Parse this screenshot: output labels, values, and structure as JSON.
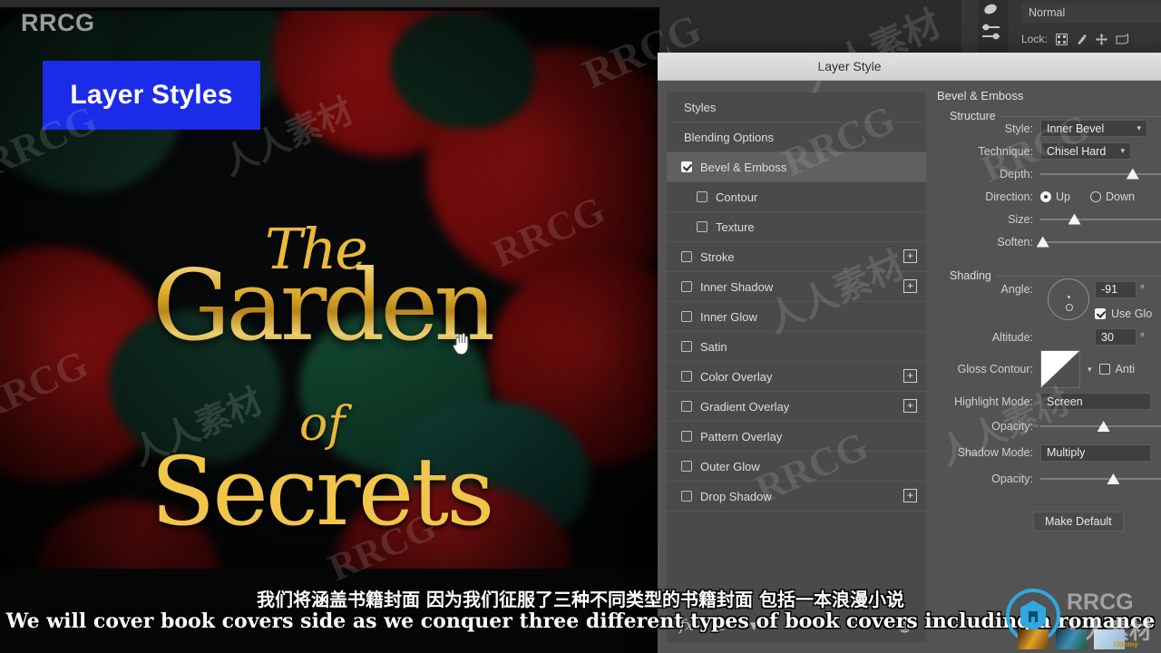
{
  "watermark": {
    "brand": "RRCG",
    "brand_cjk": "人人素材",
    "corner_label": "RRCG",
    "udemy": "Udemy",
    "tiles": [
      "RRCG",
      "人人素材",
      "RRCG",
      "RRCG",
      "人人素材",
      "RRCG",
      "人人素材",
      "RRCG"
    ]
  },
  "canvas": {
    "chip_label": "Layer Styles",
    "chip_color": "#1b2ce8",
    "cover_title_line1": "The",
    "cover_title_line2": "Garden",
    "cover_title_line3": "of",
    "cover_title_line4": "Secrets",
    "cursor": "hand-cursor"
  },
  "photoshop": {
    "blend_mode": "Normal",
    "lock_label": "Lock:",
    "lock_icons": [
      "lock-transparent-pixels-icon",
      "lock-image-pixels-icon",
      "lock-position-icon",
      "lock-artboard-icon"
    ]
  },
  "dialog": {
    "title": "Layer Style",
    "styles_list": [
      {
        "label": "Styles",
        "type": "plain",
        "checkbox": null,
        "plus": false,
        "selected": false,
        "indent": 0
      },
      {
        "label": "Blending Options",
        "type": "plain",
        "checkbox": null,
        "plus": false,
        "selected": false,
        "indent": 0
      },
      {
        "label": "Bevel & Emboss",
        "type": "check",
        "checkbox": true,
        "plus": false,
        "selected": true,
        "indent": 0
      },
      {
        "label": "Contour",
        "type": "check",
        "checkbox": false,
        "plus": false,
        "selected": false,
        "indent": 1
      },
      {
        "label": "Texture",
        "type": "check",
        "checkbox": false,
        "plus": false,
        "selected": false,
        "indent": 1
      },
      {
        "label": "Stroke",
        "type": "check",
        "checkbox": false,
        "plus": true,
        "selected": false,
        "indent": 0
      },
      {
        "label": "Inner Shadow",
        "type": "check",
        "checkbox": false,
        "plus": true,
        "selected": false,
        "indent": 0
      },
      {
        "label": "Inner Glow",
        "type": "check",
        "checkbox": false,
        "plus": false,
        "selected": false,
        "indent": 0
      },
      {
        "label": "Satin",
        "type": "check",
        "checkbox": false,
        "plus": false,
        "selected": false,
        "indent": 0
      },
      {
        "label": "Color Overlay",
        "type": "check",
        "checkbox": false,
        "plus": true,
        "selected": false,
        "indent": 0
      },
      {
        "label": "Gradient Overlay",
        "type": "check",
        "checkbox": false,
        "plus": true,
        "selected": false,
        "indent": 0
      },
      {
        "label": "Pattern Overlay",
        "type": "check",
        "checkbox": false,
        "plus": false,
        "selected": false,
        "indent": 0
      },
      {
        "label": "Outer Glow",
        "type": "check",
        "checkbox": false,
        "plus": false,
        "selected": false,
        "indent": 0
      },
      {
        "label": "Drop Shadow",
        "type": "check",
        "checkbox": false,
        "plus": true,
        "selected": false,
        "indent": 0
      }
    ],
    "styles_footer": {
      "fx": "fx",
      "move_up": "▲",
      "move_down": "▼",
      "delete": "trash-icon"
    },
    "panel": {
      "heading": "Bevel & Emboss",
      "structure_label": "Structure",
      "style_label": "Style:",
      "style_value": "Inner Bevel",
      "technique_label": "Technique:",
      "technique_value": "Chisel Hard",
      "depth_label": "Depth:",
      "depth_knob_pct": 76,
      "direction_label": "Direction:",
      "direction_up": "Up",
      "direction_down": "Down",
      "direction_value": "Up",
      "size_label": "Size:",
      "size_knob_pct": 28,
      "soften_label": "Soften:",
      "soften_knob_pct": 2,
      "shading_label": "Shading",
      "angle_label": "Angle:",
      "angle_value": "-91",
      "use_global_light": "Use Glo",
      "use_global_light_checked": true,
      "altitude_label": "Altitude:",
      "altitude_value": "30",
      "gloss_contour_label": "Gloss Contour:",
      "anti_alias_label": "Anti",
      "anti_alias_checked": false,
      "highlight_mode_label": "Highlight Mode:",
      "highlight_mode_value": "Screen",
      "highlight_opacity_label": "Opacity:",
      "highlight_opacity_knob_pct": 52,
      "shadow_mode_label": "Shadow Mode:",
      "shadow_mode_value": "Multiply",
      "shadow_opacity_label": "Opacity:",
      "shadow_opacity_knob_pct": 60,
      "make_default_label": "Make Default"
    }
  },
  "subtitles": {
    "chinese": "我们将涵盖书籍封面 因为我们征服了三种不同类型的书籍封面 包括一本浪漫小说",
    "english": "We will cover book covers side as we conquer three different types of book covers including a romance"
  }
}
